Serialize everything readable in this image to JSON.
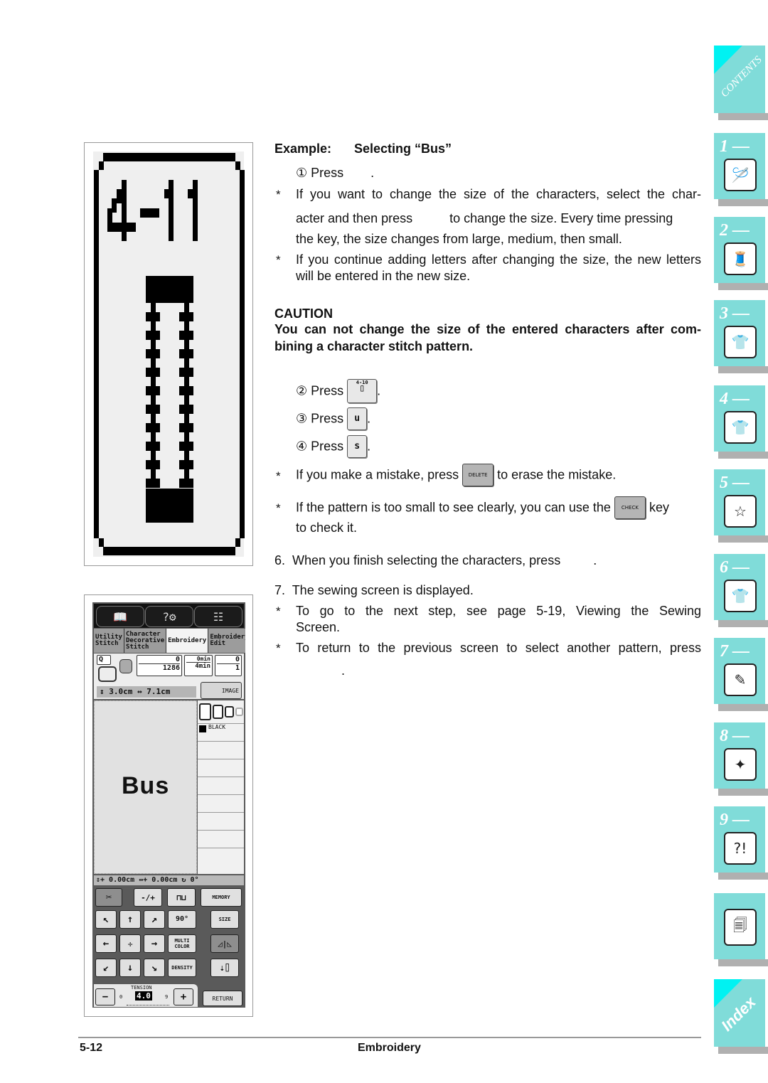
{
  "illustration_key": {
    "label": "4-11",
    "description": "large key pattern button"
  },
  "lcd_screen": {
    "top_buttons": [
      "manual-icon",
      "help-icon",
      "settings-icon"
    ],
    "tabs": [
      {
        "label": "Utility Stitch",
        "active": false
      },
      {
        "label": "Character Decorative Stitch",
        "active": false
      },
      {
        "label": "Embroidery",
        "active": true
      },
      {
        "label": "Embroidery Edit",
        "active": false
      }
    ],
    "frame_letter": "Q",
    "stitch_count_top": "0",
    "stitch_count_total": "1286",
    "time_top": "0min",
    "time_total": "4min",
    "color_top": "0",
    "color_total": "1",
    "size_readout": "↕ 3.0cm ↔ 7.1cm",
    "image_button": "IMAGE",
    "pattern_text": "Bus",
    "thread_color": "BLACK",
    "position_readout": "⇕+ 0.00cm ↔+ 0.00cm ↻ 0°",
    "buttons": {
      "memory": "MEMORY",
      "rotate": "90°",
      "size": "SIZE",
      "multi_color": "MULTI COLOR",
      "density": "DENSITY",
      "return": "RETURN",
      "plus_minus": "-/+"
    },
    "tension": {
      "label": "TENSION",
      "value": "4.0",
      "min": "0",
      "max": "9"
    }
  },
  "content": {
    "example_heading": "Example:",
    "example_title": "Selecting “Bus”",
    "step1": "① Press",
    "step1_end": ".",
    "note_size_1": "If you want to change the size of the characters, select the char-",
    "note_size_2a": "acter and then press",
    "note_size_2b": "to change the size. Every time pressing",
    "note_size_3": "the key, the size changes from large, medium, then small.",
    "note_continue": "If you continue adding letters after changing the size, the new letters will be entered in the new size.",
    "caution_heading": "CAUTION",
    "caution_text": "You can not change the size of the entered characters after com-bining a character stitch pattern.",
    "caution_line1": "You can not change the size of the entered characters after com-",
    "caution_line2": "bining a character stitch pattern.",
    "step2": "② Press",
    "step2_key": "4-10",
    "step3": "③ Press",
    "step3_key": "u",
    "step4": "④ Press",
    "step4_key": "s",
    "note_delete_a": "If you make a mistake, press",
    "delete_key": "DELETE",
    "note_delete_b": "to erase the mistake.",
    "note_check_a": "If the pattern is too small to see clearly, you can use the",
    "check_key": "CHECK",
    "note_check_b": "key",
    "note_check_c": "to check it.",
    "step6": "6.  When you finish selecting the characters, press",
    "step6_end": ".",
    "step7": "7.  The sewing screen is displayed.",
    "note_next_1": "To go to the next step, see page 5-19,  Viewing the Sewing",
    "note_next_2": "Screen.",
    "note_return": "To return to the previous screen to select another pattern, press",
    "note_return_end": ".",
    "asterisk": "*"
  },
  "right_tabs": [
    {
      "label": "CONTENTS",
      "icon": "contents-icon"
    },
    {
      "label": "1 —",
      "icon": "sewing-machine-hand-icon"
    },
    {
      "label": "2 —",
      "icon": "thread-spool-scissors-icon"
    },
    {
      "label": "3 —",
      "icon": "shirt-icon"
    },
    {
      "label": "4 —",
      "icon": "shirt-abc-icon"
    },
    {
      "label": "5 —",
      "icon": "embroidery-frame-star-icon"
    },
    {
      "label": "6 —",
      "icon": "shirt-abc-arc-icon"
    },
    {
      "label": "7 —",
      "icon": "shirt-pencil-icon"
    },
    {
      "label": "8 —",
      "icon": "sewing-machine-sparkle-icon"
    },
    {
      "label": "9 —",
      "icon": "sewing-machine-question-icon"
    },
    {
      "label": "",
      "icon": "documents-icon"
    },
    {
      "label": "Index",
      "icon": "index-icon"
    }
  ],
  "footer": {
    "page_number": "5-12",
    "section": "Embroidery"
  },
  "colors": {
    "tab_bg": "#80dcd9",
    "tab_accent": "#00f2f2",
    "tab_shadow": "#b0b0b0"
  }
}
